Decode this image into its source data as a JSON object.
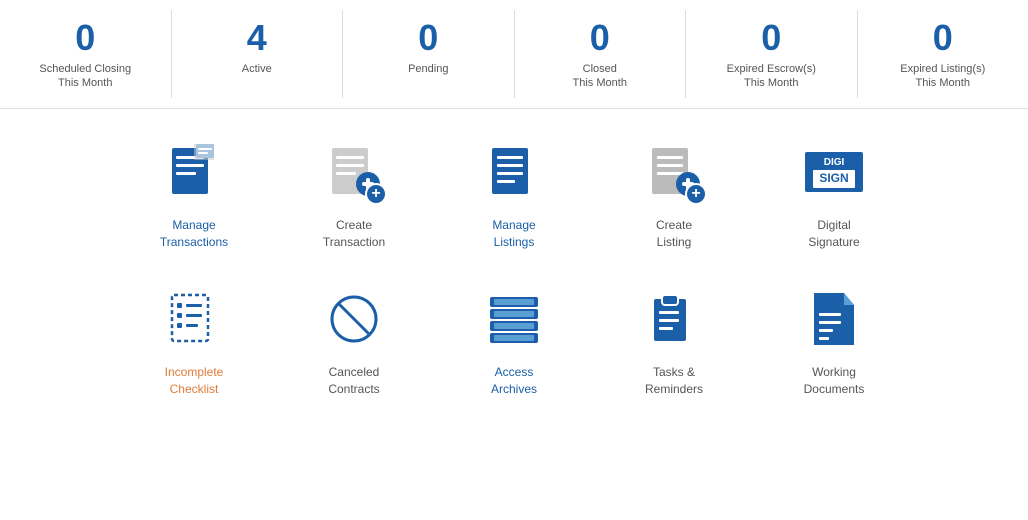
{
  "stats": [
    {
      "id": "scheduled-closing",
      "number": "0",
      "label": "Scheduled Closing\nThis Month"
    },
    {
      "id": "active",
      "number": "4",
      "label": "Active"
    },
    {
      "id": "pending",
      "number": "0",
      "label": "Pending"
    },
    {
      "id": "closed-this-month",
      "number": "0",
      "label": "Closed\nThis Month"
    },
    {
      "id": "expired-escrow",
      "number": "0",
      "label": "Expired Escrow(s)\nThis Month"
    },
    {
      "id": "expired-listing",
      "number": "0",
      "label": "Expired Listing(s)\nThis Month"
    }
  ],
  "row1": [
    {
      "id": "manage-transactions",
      "label": "Manage\nTransactions",
      "labelColor": "blue",
      "iconType": "manage-transactions"
    },
    {
      "id": "create-transaction",
      "label": "Create\nTransaction",
      "labelColor": "normal",
      "iconType": "create-transaction"
    },
    {
      "id": "manage-listings",
      "label": "Manage\nListings",
      "labelColor": "blue",
      "iconType": "manage-listings"
    },
    {
      "id": "create-listing",
      "label": "Create\nListing",
      "labelColor": "normal",
      "iconType": "create-listing"
    },
    {
      "id": "digital-signature",
      "label": "Digital\nSignature",
      "labelColor": "normal",
      "iconType": "digital-signature"
    }
  ],
  "row2": [
    {
      "id": "incomplete-checklist",
      "label": "Incomplete\nChecklist",
      "labelColor": "orange",
      "iconType": "incomplete-checklist"
    },
    {
      "id": "canceled-contracts",
      "label": "Canceled\nContracts",
      "labelColor": "normal",
      "iconType": "canceled-contracts"
    },
    {
      "id": "access-archives",
      "label": "Access\nArchives",
      "labelColor": "blue",
      "iconType": "access-archives"
    },
    {
      "id": "tasks-reminders",
      "label": "Tasks &\nReminders",
      "labelColor": "normal",
      "iconType": "tasks-reminders"
    },
    {
      "id": "working-documents",
      "label": "Working\nDocuments",
      "labelColor": "normal",
      "iconType": "working-documents"
    }
  ]
}
